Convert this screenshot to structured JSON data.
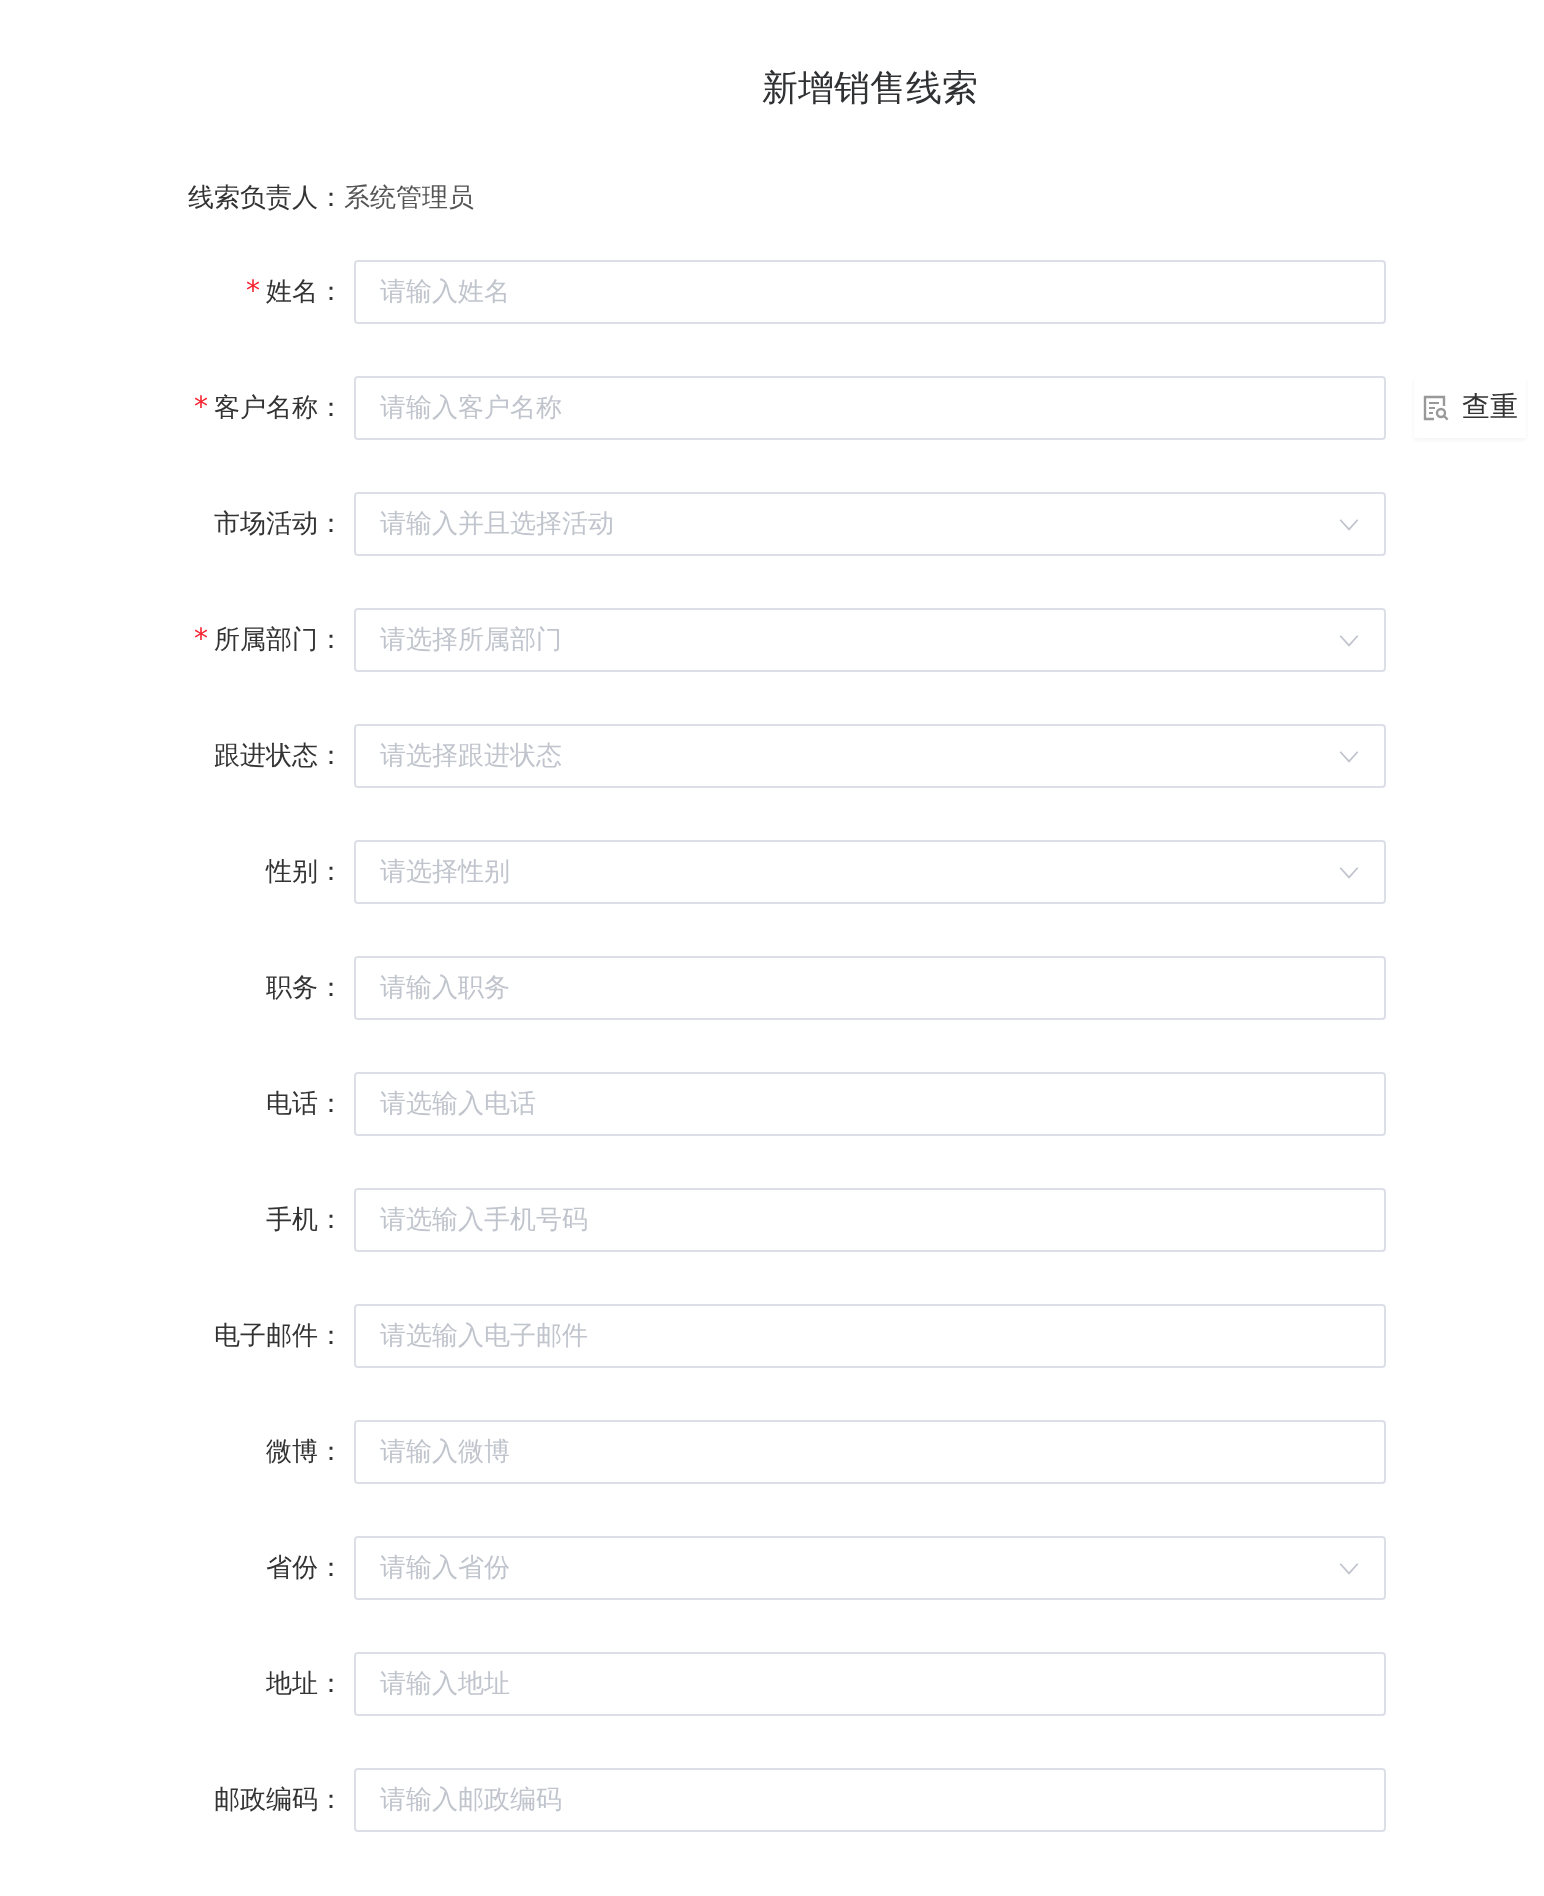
{
  "title": "新增销售线索",
  "owner": {
    "label": "线索负责人：",
    "value": "系统管理员"
  },
  "fields": [
    {
      "mark": "*",
      "label": "姓名：",
      "placeholder": "请输入姓名",
      "kind": "input"
    },
    {
      "mark": "*",
      "label": "客户名称：",
      "placeholder": "请输入客户名称",
      "kind": "input",
      "action": "查重"
    },
    {
      "label": "市场活动：",
      "placeholder": "请输入并且选择活动",
      "kind": "select"
    },
    {
      "mark": "*",
      "label": "所属部门：",
      "placeholder": "请选择所属部门",
      "kind": "select"
    },
    {
      "label": "跟进状态：",
      "placeholder": "请选择跟进状态",
      "kind": "select"
    },
    {
      "label": "性别：",
      "placeholder": "请选择性别",
      "kind": "select"
    },
    {
      "label": "职务：",
      "placeholder": "请输入职务",
      "kind": "input"
    },
    {
      "label": "电话：",
      "placeholder": "请选输入电话",
      "kind": "input"
    },
    {
      "label": "手机：",
      "placeholder": "请选输入手机号码",
      "kind": "input"
    },
    {
      "label": "电子邮件：",
      "placeholder": "请选输入电子邮件",
      "kind": "input"
    },
    {
      "label": "微博：",
      "placeholder": "请输入微博",
      "kind": "input"
    },
    {
      "label": "省份：",
      "placeholder": "请输入省份",
      "kind": "select"
    },
    {
      "label": "地址：",
      "placeholder": "请输入地址",
      "kind": "input"
    },
    {
      "label": "邮政编码：",
      "placeholder": "请输入邮政编码",
      "kind": "input"
    }
  ]
}
